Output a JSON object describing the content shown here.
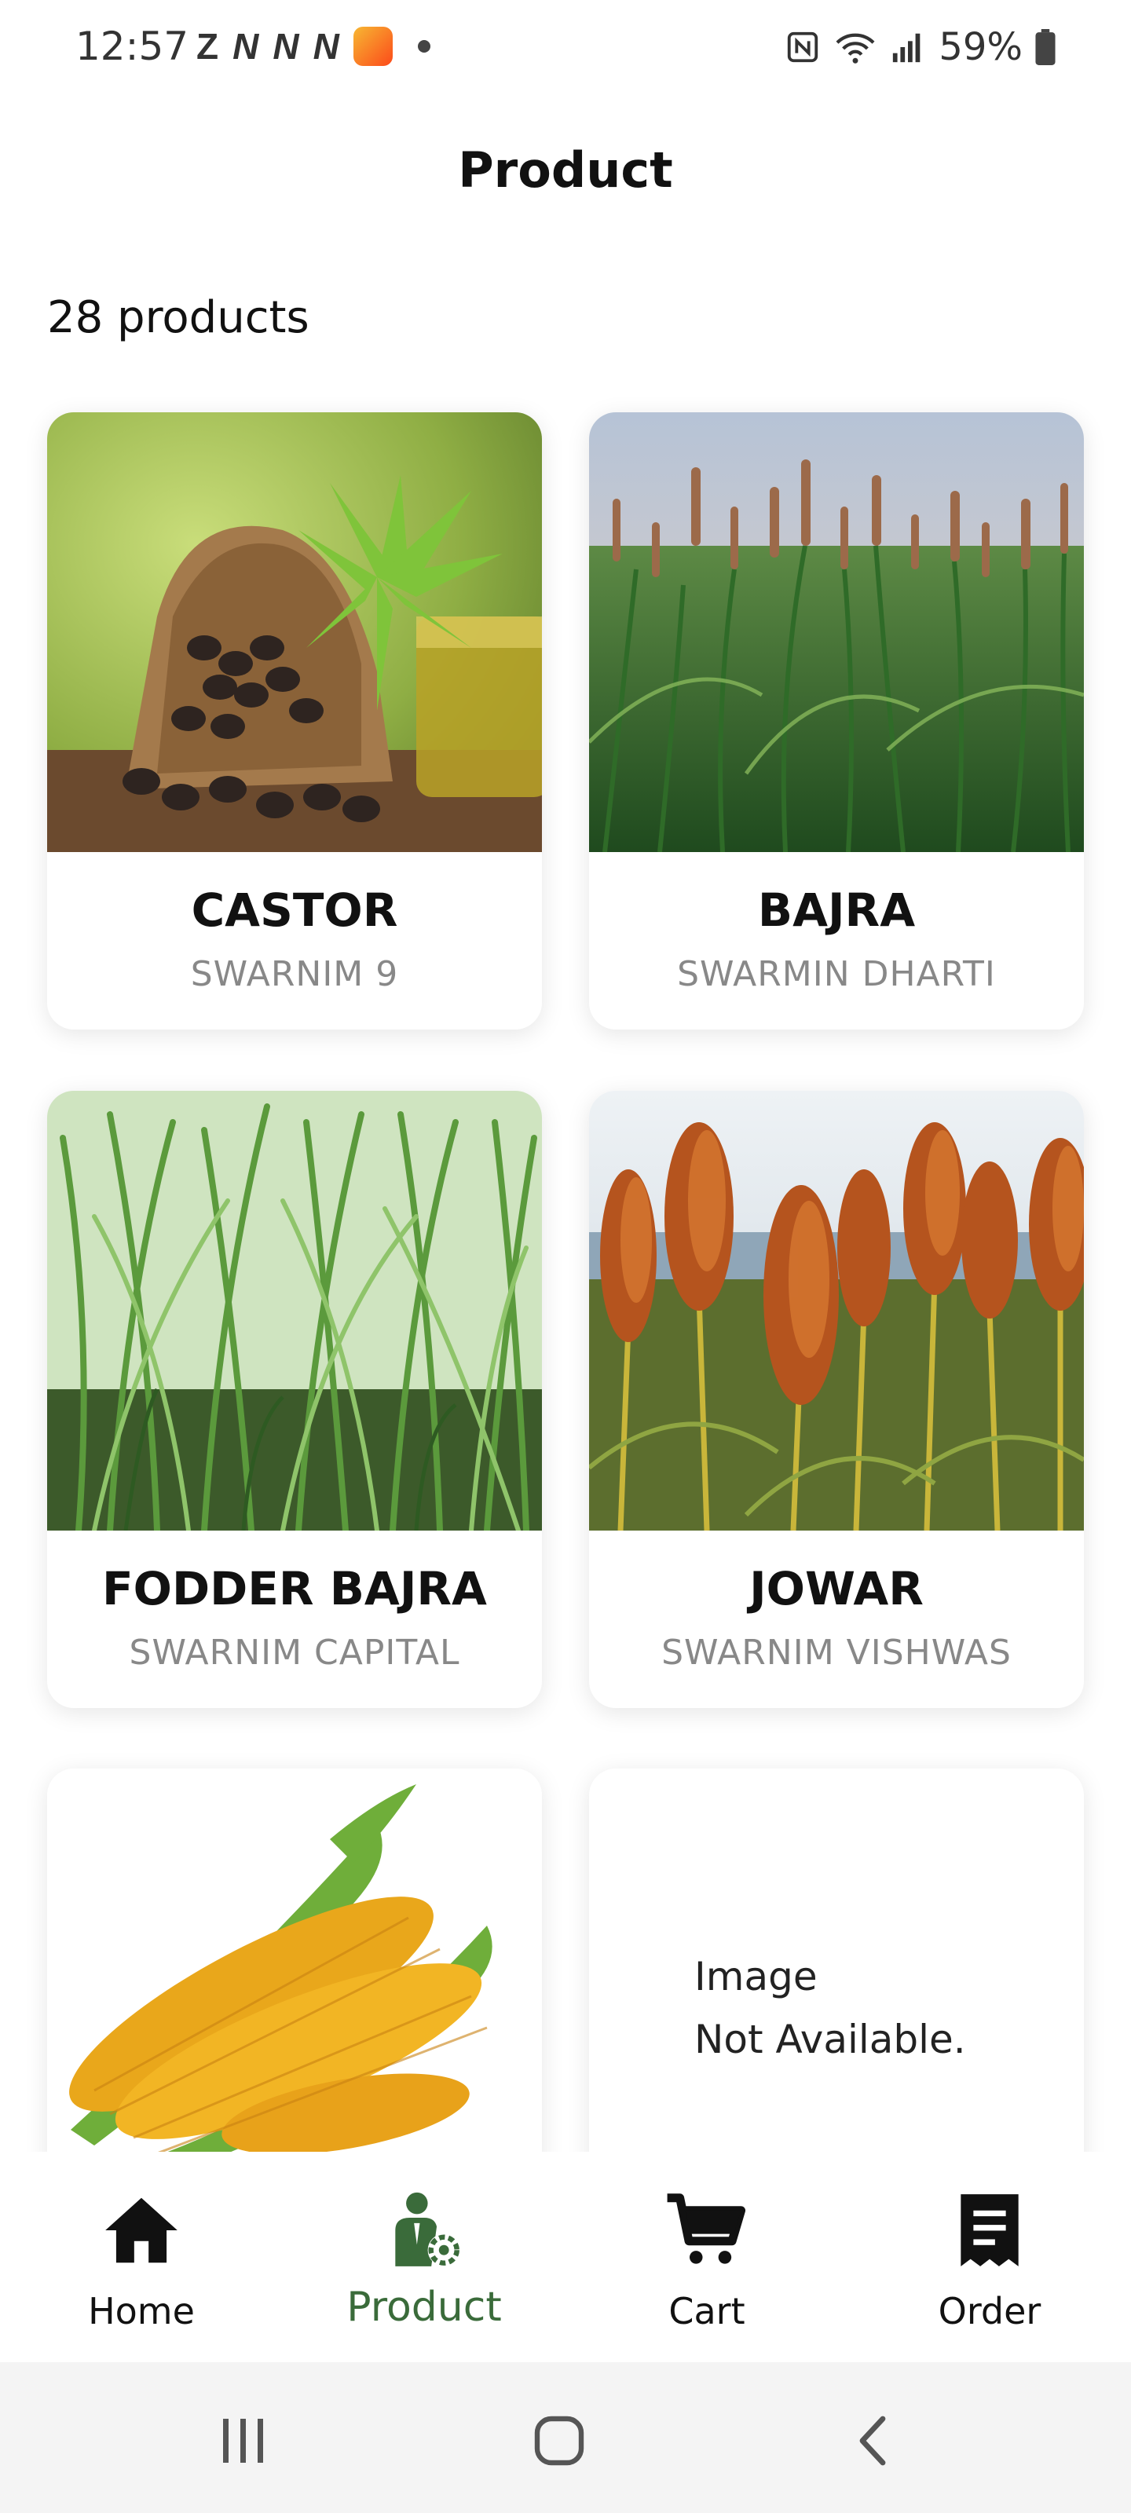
{
  "status_bar": {
    "time": "12:57",
    "notif_icons": [
      "Z",
      "N",
      "N",
      "N"
    ],
    "battery": "59%"
  },
  "header": {
    "title": "Product"
  },
  "summary": {
    "count_text": "28 products"
  },
  "products": [
    {
      "name": "CASTOR",
      "variety": "SWARNIM 9",
      "image": "castor-image"
    },
    {
      "name": "BAJRA",
      "variety": "SWARMIN DHARTI",
      "image": "bajra-image"
    },
    {
      "name": "FODDER BAJRA",
      "variety": "SWARNIM CAPITAL",
      "image": "fodder-bajra-image"
    },
    {
      "name": "JOWAR",
      "variety": "SWARNIM VISHWAS",
      "image": "jowar-image"
    },
    {
      "name": "",
      "variety": "",
      "image": "maize-image"
    },
    {
      "name": "",
      "variety": "",
      "image": "image-unavailable",
      "placeholder_line1": "Image",
      "placeholder_line2": "Not Available."
    }
  ],
  "bottom_nav": {
    "items": [
      {
        "label": "Home",
        "icon": "home-icon"
      },
      {
        "label": "Product",
        "icon": "product-icon",
        "active": true
      },
      {
        "label": "Cart",
        "icon": "cart-icon"
      },
      {
        "label": "Order",
        "icon": "order-icon"
      }
    ],
    "active_color": "#3a6b3a"
  },
  "system_nav": {
    "buttons": [
      "recent-apps-icon",
      "home-circle-icon",
      "back-icon"
    ]
  }
}
